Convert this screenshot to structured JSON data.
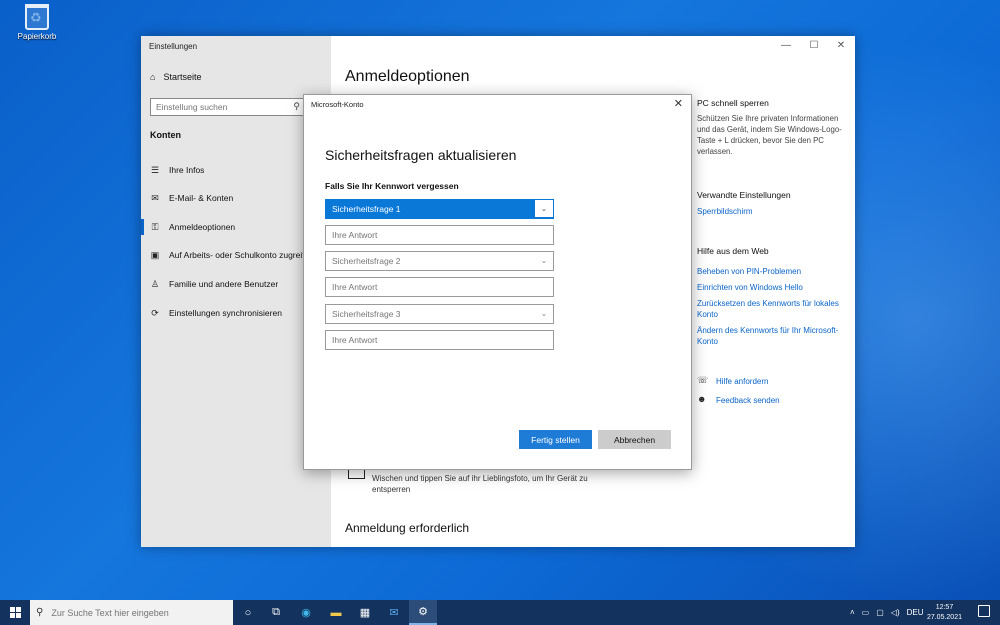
{
  "desktop": {
    "recycle_bin_label": "Papierkorb"
  },
  "settings": {
    "window_title": "Einstellungen",
    "home_label": "Startseite",
    "search_placeholder": "Einstellung suchen",
    "section_title": "Konten",
    "nav_items": [
      {
        "label": "Ihre Infos",
        "icon": "person-card-icon"
      },
      {
        "label": "E-Mail- & Konten",
        "icon": "mail-icon"
      },
      {
        "label": "Anmeldeoptionen",
        "icon": "key-icon",
        "active": true
      },
      {
        "label": "Auf Arbeits- oder Schulkonto zugreifen",
        "icon": "briefcase-icon"
      },
      {
        "label": "Familie und andere Benutzer",
        "icon": "person-add-icon"
      },
      {
        "label": "Einstellungen synchronisieren",
        "icon": "sync-icon"
      }
    ],
    "page_title": "Anmeldeoptionen",
    "picture_password_text": "Wischen und tippen Sie auf ihr Lieblingsfoto, um Ihr Gerät zu entsperren",
    "sign_in_required_title": "Anmeldung erforderlich",
    "right": {
      "lock_title": "PC schnell sperren",
      "lock_text": "Schützen Sie Ihre privaten Informationen und das Gerät, indem Sie Windows-Logo-Taste + L drücken, bevor Sie den PC verlassen.",
      "related_title": "Verwandte Einstellungen",
      "related_link": "Sperrbildschirm",
      "web_help_title": "Hilfe aus dem Web",
      "web_links": [
        "Beheben von PIN-Problemen",
        "Einrichten von Windows Hello",
        "Zurücksetzen des Kennworts für lokales Konto",
        "Ändern des Kennworts für Ihr Microsoft-Konto"
      ],
      "get_help": "Hilfe anfordern",
      "feedback": "Feedback senden"
    }
  },
  "dialog": {
    "title": "Microsoft-Konto",
    "heading": "Sicherheitsfragen aktualisieren",
    "subheading": "Falls Sie Ihr Kennwort vergessen",
    "questions": [
      {
        "select": "Sicherheitsfrage 1",
        "answer_placeholder": "Ihre Antwort"
      },
      {
        "select": "Sicherheitsfrage 2",
        "answer_placeholder": "Ihre Antwort"
      },
      {
        "select": "Sicherheitsfrage 3",
        "answer_placeholder": "Ihre Antwort"
      }
    ],
    "finish_button": "Fertig stellen",
    "cancel_button": "Abbrechen"
  },
  "taskbar": {
    "search_placeholder": "Zur Suche Text hier eingeben",
    "language": "DEU",
    "time": "12:57",
    "date": "27.05.2021"
  },
  "colors": {
    "accent": "#0a78d7",
    "taskbar": "#13325e",
    "link": "#0a64c8"
  }
}
